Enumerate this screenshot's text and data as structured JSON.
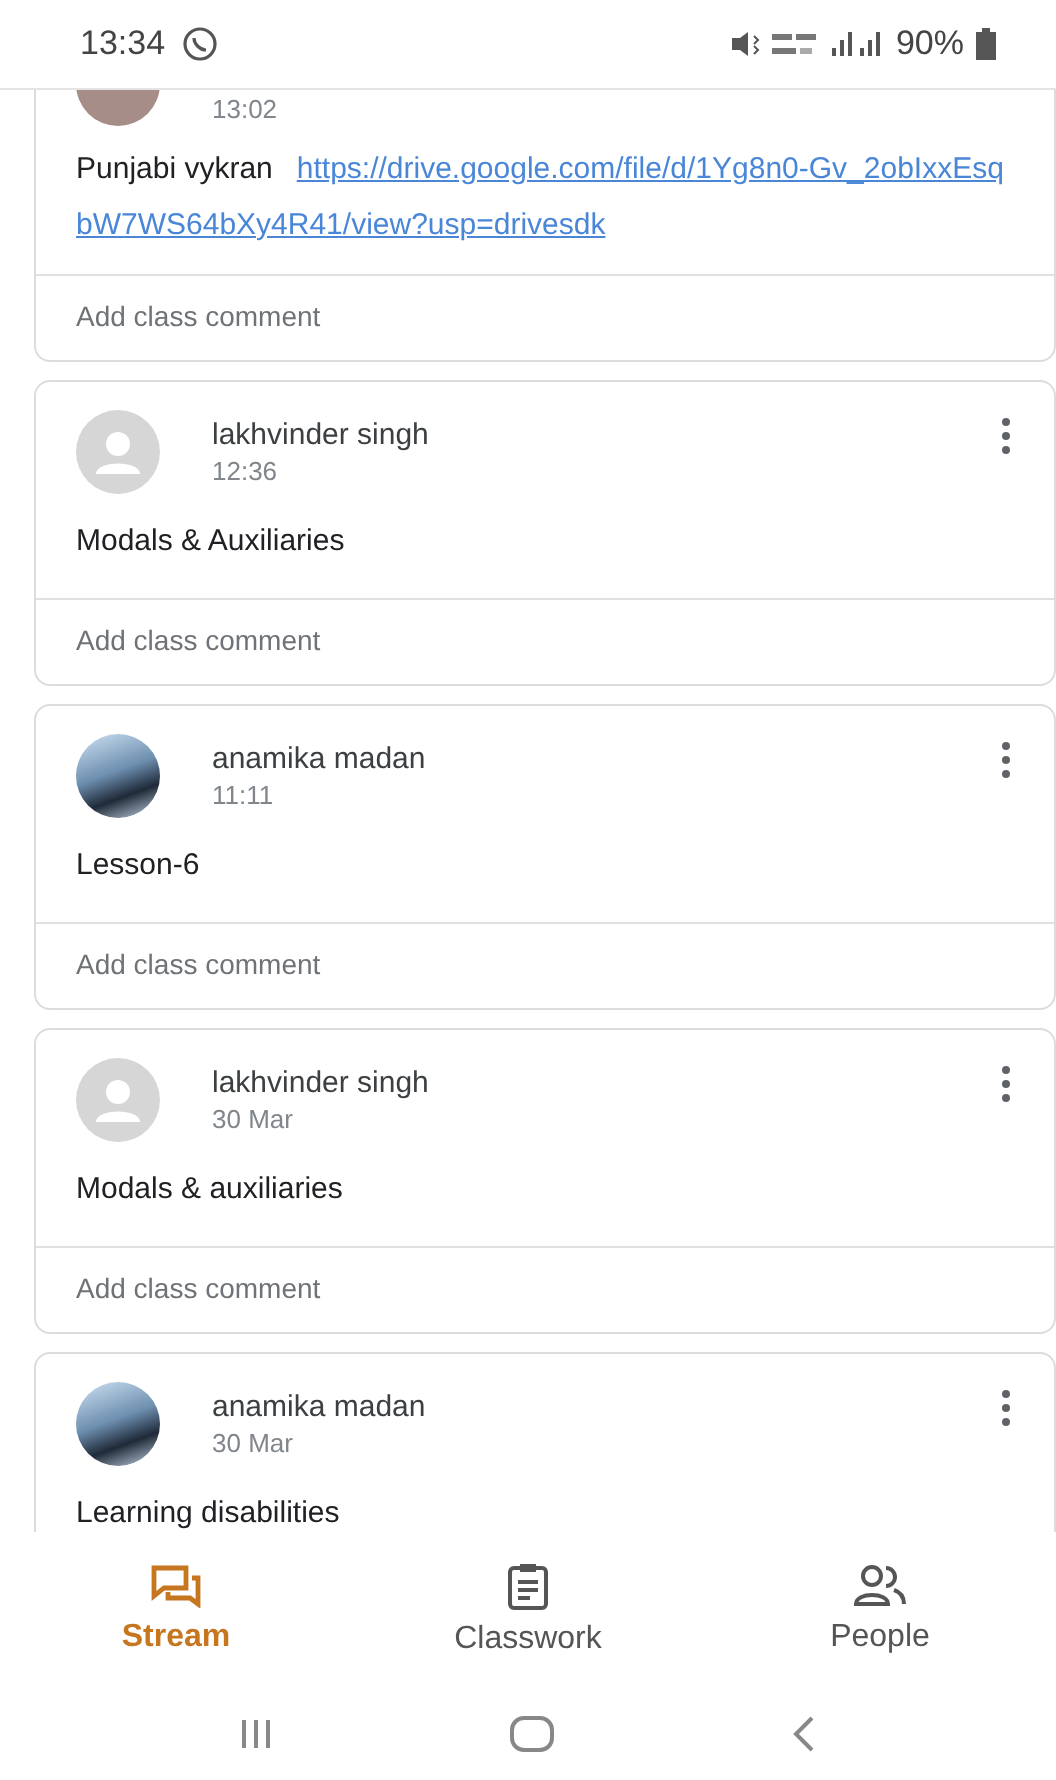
{
  "status_bar": {
    "time": "13:34",
    "battery": "90%"
  },
  "posts": [
    {
      "kind": "cut",
      "time": "13:02",
      "text": "Punjabi vykran",
      "link": "https://drive.google.com/file/d/1Yg8n0-Gv_2obIxxEsqbW7WS64bXy4R41/view?usp=drivesdk",
      "comment_placeholder": "Add class comment"
    },
    {
      "kind": "default",
      "author": "lakhvinder singh",
      "time": "12:36",
      "text": "Modals & Auxiliaries",
      "comment_placeholder": "Add class comment"
    },
    {
      "kind": "photo",
      "author": "anamika madan",
      "time": "11:11",
      "text": "Lesson-6",
      "comment_placeholder": "Add class comment"
    },
    {
      "kind": "default",
      "author": "lakhvinder singh",
      "time": "30 Mar",
      "text": "Modals & auxiliaries",
      "comment_placeholder": "Add class comment"
    },
    {
      "kind": "photo",
      "author": "anamika madan",
      "time": "30 Mar",
      "text": "Learning disabilities"
    }
  ],
  "bottom_nav": [
    {
      "label": "Stream",
      "selected": true
    },
    {
      "label": "Classwork",
      "selected": false
    },
    {
      "label": "People",
      "selected": false
    }
  ]
}
